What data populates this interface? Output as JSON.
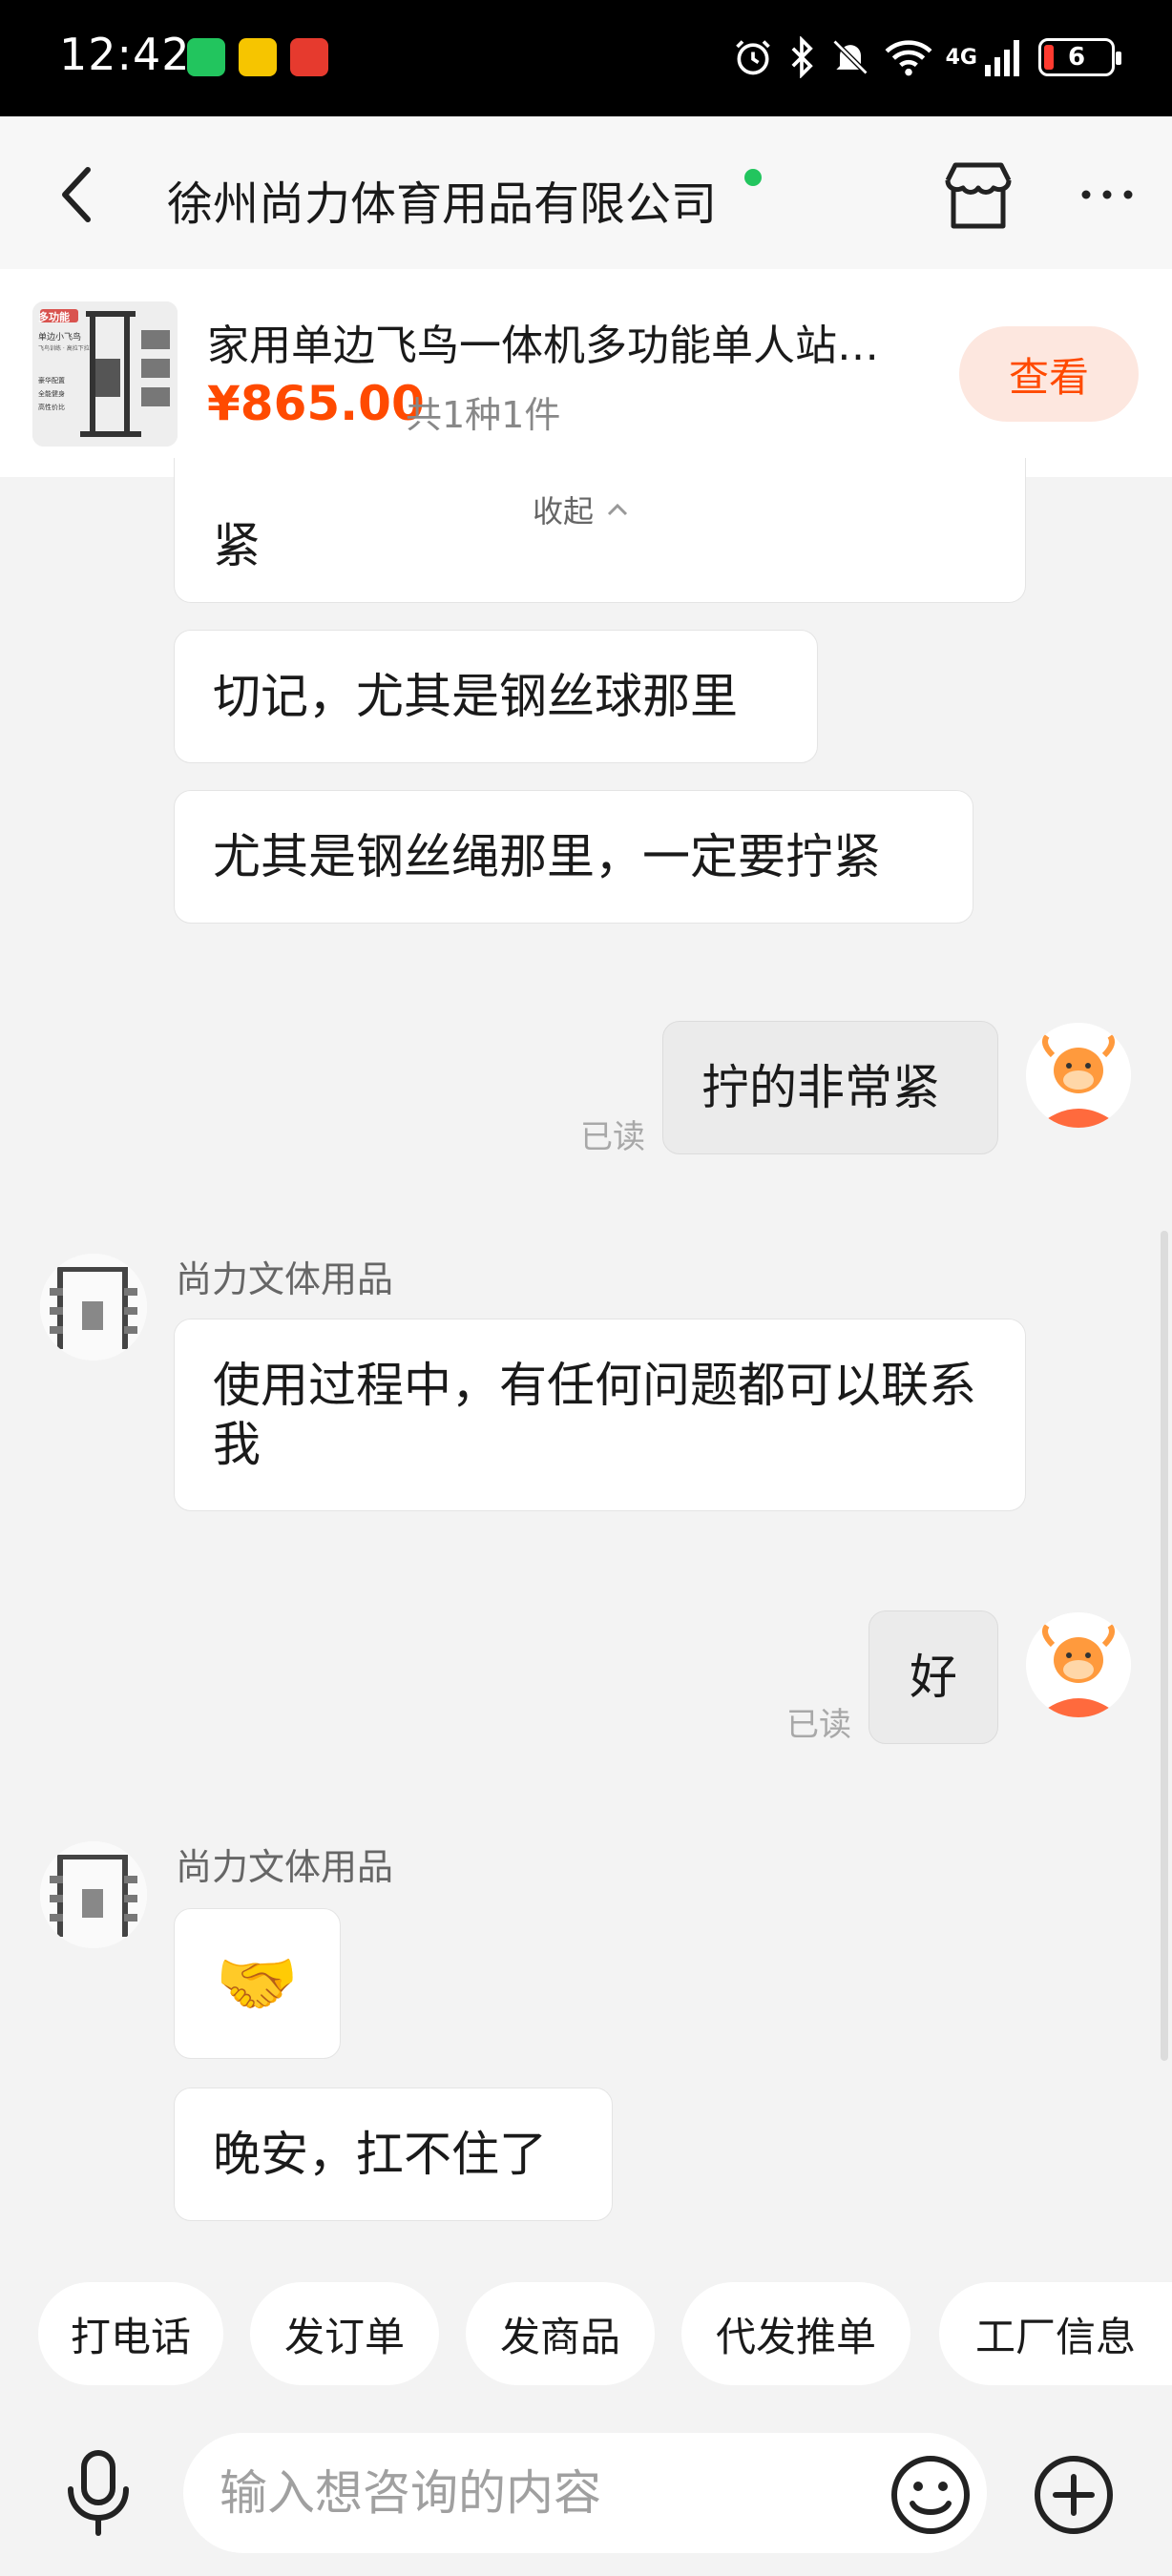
{
  "status_bar": {
    "time": "12:42",
    "network": "4G",
    "battery": "6",
    "app_icons": [
      "green-a-app-icon",
      "yellow-face-app-icon",
      "red-news-app-icon"
    ]
  },
  "header": {
    "title": "徐州尚力体育用品有限公司",
    "online": true
  },
  "product": {
    "title": "家用单边飞鸟一体机多功能单人站…",
    "price": "¥865.00",
    "count": "共1种1件",
    "view_label": "查看",
    "thumb_text": [
      "多功能",
      "单边小飞鸟",
      "飞鸟训练 · 高拉下拉",
      "豪华配置",
      "全能健身",
      "高性价比"
    ]
  },
  "messages": {
    "collapse_label": "收起",
    "m1_tail": "紧",
    "m2": "切记，尤其是钢丝球那里",
    "m3": "尤其是钢丝绳那里，一定要拧紧",
    "m4": "拧的非常紧",
    "read_label": "已读",
    "sender": "尚力文体用品",
    "m5": "使用过程中，有任何问题都可以联系我",
    "m6": "好",
    "m7_emoji": "🤝",
    "m8": "晚安，扛不住了"
  },
  "quick_actions": [
    "打电话",
    "发订单",
    "发商品",
    "代发推单",
    "工厂信息"
  ],
  "input": {
    "placeholder": "输入想咨询的内容"
  },
  "colors": {
    "accent": "#ff4a00",
    "online": "#22c55e",
    "view_button_bg": "#fde7df"
  }
}
